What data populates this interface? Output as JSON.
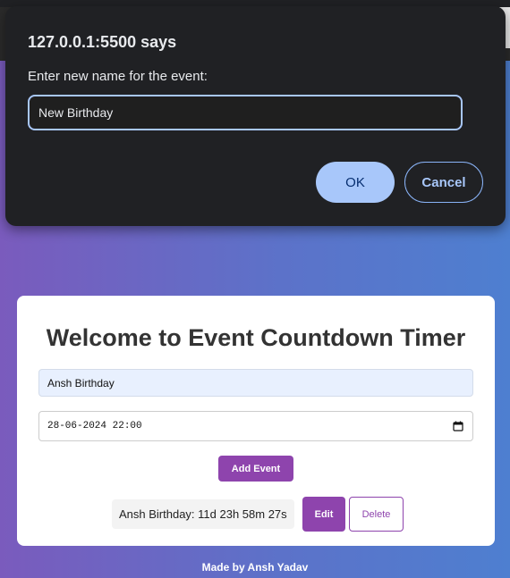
{
  "dialog": {
    "title": "127.0.0.1:5500 says",
    "message": "Enter new name for the event:",
    "input_value": "New Birthday",
    "ok_label": "OK",
    "cancel_label": "Cancel",
    "accent_color": "#a8c7fa"
  },
  "card": {
    "title": "Welcome to Event Countdown Timer",
    "name_input_value": "Ansh Birthday",
    "datetime_value": "28-06-2024 22:00",
    "calendar_icon": "calendar-icon",
    "add_button_label": "Add Event",
    "event": {
      "text": "Ansh Birthday: 11d 23h 58m 27s",
      "edit_label": "Edit",
      "delete_label": "Delete"
    },
    "brand_color": "#8e44ad"
  },
  "footer": {
    "text": "Made by Ansh Yadav"
  }
}
